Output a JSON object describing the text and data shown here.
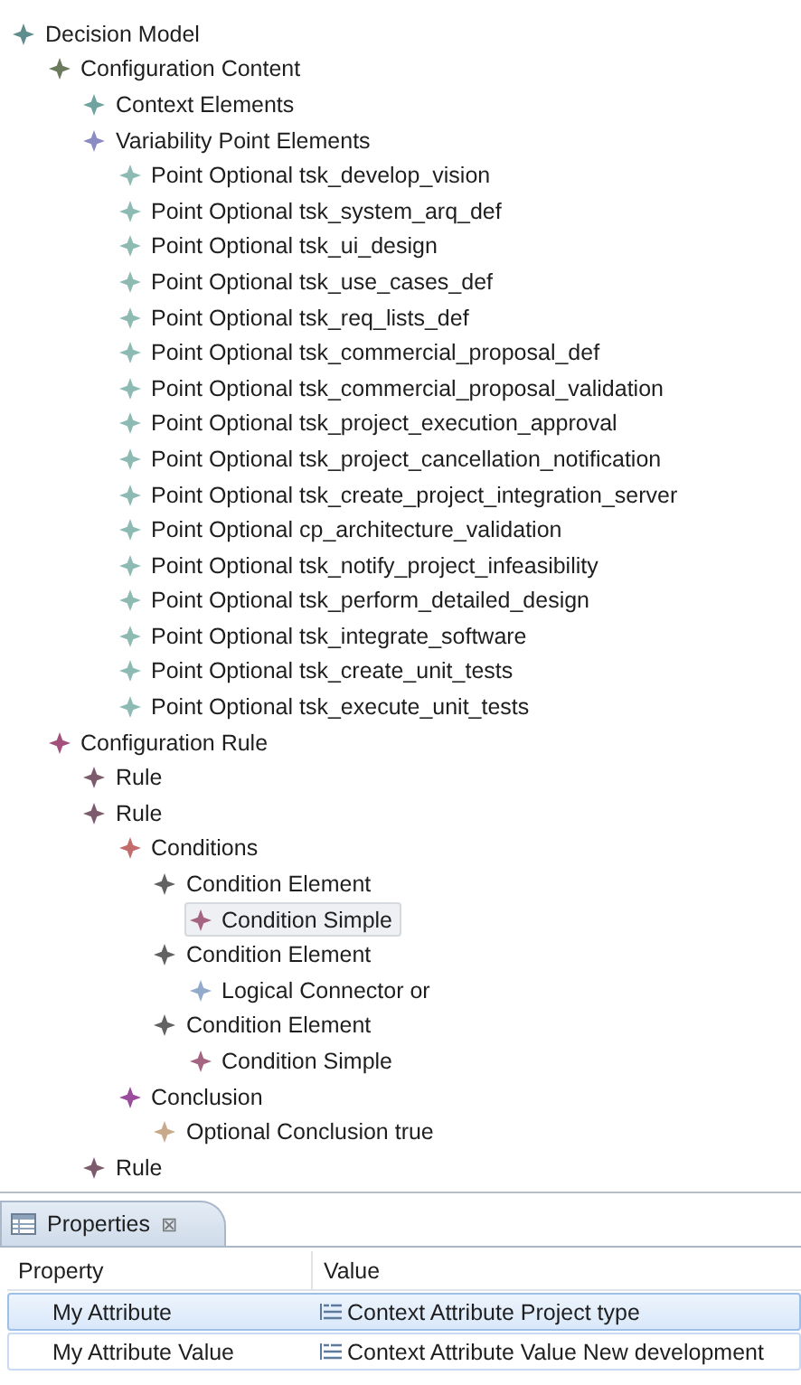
{
  "tree": [
    {
      "label": "Decision Model",
      "color": "#5f8c8c",
      "selected": false,
      "children": [
        {
          "label": "Configuration Content",
          "color": "#6b7a5c",
          "selected": false,
          "children": [
            {
              "label": "Context Elements",
              "color": "#6fa3a0",
              "selected": false
            },
            {
              "label": "Variability Point Elements",
              "color": "#8c8cc4",
              "selected": false,
              "children": [
                {
                  "label": "Point Optional tsk_develop_vision",
                  "color": "#8dbab2",
                  "selected": false
                },
                {
                  "label": "Point Optional tsk_system_arq_def",
                  "color": "#8dbab2",
                  "selected": false
                },
                {
                  "label": "Point Optional tsk_ui_design",
                  "color": "#8dbab2",
                  "selected": false
                },
                {
                  "label": "Point Optional tsk_use_cases_def",
                  "color": "#8dbab2",
                  "selected": false
                },
                {
                  "label": "Point Optional tsk_req_lists_def",
                  "color": "#8dbab2",
                  "selected": false
                },
                {
                  "label": "Point Optional tsk_commercial_proposal_def",
                  "color": "#8dbab2",
                  "selected": false
                },
                {
                  "label": "Point Optional tsk_commercial_proposal_validation",
                  "color": "#8dbab2",
                  "selected": false
                },
                {
                  "label": "Point Optional tsk_project_execution_approval",
                  "color": "#8dbab2",
                  "selected": false
                },
                {
                  "label": "Point Optional tsk_project_cancellation_notification",
                  "color": "#8dbab2",
                  "selected": false
                },
                {
                  "label": "Point Optional tsk_create_project_integration_server",
                  "color": "#8dbab2",
                  "selected": false
                },
                {
                  "label": "Point Optional cp_architecture_validation",
                  "color": "#8dbab2",
                  "selected": false
                },
                {
                  "label": "Point Optional tsk_notify_project_infeasibility",
                  "color": "#8dbab2",
                  "selected": false
                },
                {
                  "label": "Point Optional tsk_perform_detailed_design",
                  "color": "#8dbab2",
                  "selected": false
                },
                {
                  "label": "Point Optional tsk_integrate_software",
                  "color": "#8dbab2",
                  "selected": false
                },
                {
                  "label": "Point Optional tsk_create_unit_tests",
                  "color": "#8dbab2",
                  "selected": false
                },
                {
                  "label": "Point Optional tsk_execute_unit_tests",
                  "color": "#8dbab2",
                  "selected": false
                }
              ]
            }
          ]
        },
        {
          "label": "Configuration Rule",
          "color": "#a4507c",
          "selected": false,
          "children": [
            {
              "label": "Rule",
              "color": "#7c5c6c",
              "selected": false
            },
            {
              "label": "Rule",
              "color": "#7c5c6c",
              "selected": false,
              "children": [
                {
                  "label": "Conditions",
                  "color": "#c46c6c",
                  "selected": false,
                  "children": [
                    {
                      "label": "Condition Element",
                      "color": "#626262",
                      "selected": false,
                      "children": [
                        {
                          "label": "Condition Simple",
                          "color": "#a46482",
                          "selected": true
                        }
                      ]
                    },
                    {
                      "label": "Condition Element",
                      "color": "#626262",
                      "selected": false,
                      "children": [
                        {
                          "label": "Logical Connector or",
                          "color": "#92aacb",
                          "selected": false
                        }
                      ]
                    },
                    {
                      "label": "Condition Element",
                      "color": "#626262",
                      "selected": false,
                      "children": [
                        {
                          "label": "Condition Simple",
                          "color": "#a46482",
                          "selected": false
                        }
                      ]
                    }
                  ]
                },
                {
                  "label": "Conclusion",
                  "color": "#9c4c9c",
                  "selected": false,
                  "children": [
                    {
                      "label": "Optional Conclusion true",
                      "color": "#c8aa8a",
                      "selected": false
                    }
                  ]
                }
              ]
            },
            {
              "label": "Rule",
              "color": "#7c5c6c",
              "selected": false
            }
          ]
        }
      ]
    }
  ],
  "properties": {
    "tab": {
      "label": "Properties",
      "close": "⊠"
    },
    "columns": [
      "Property",
      "Value"
    ],
    "rows": [
      {
        "property": "My Attribute",
        "value": "Context Attribute Project type",
        "selected": true
      },
      {
        "property": "My Attribute Value",
        "value": "Context Attribute Value New development",
        "selected": false
      }
    ]
  }
}
